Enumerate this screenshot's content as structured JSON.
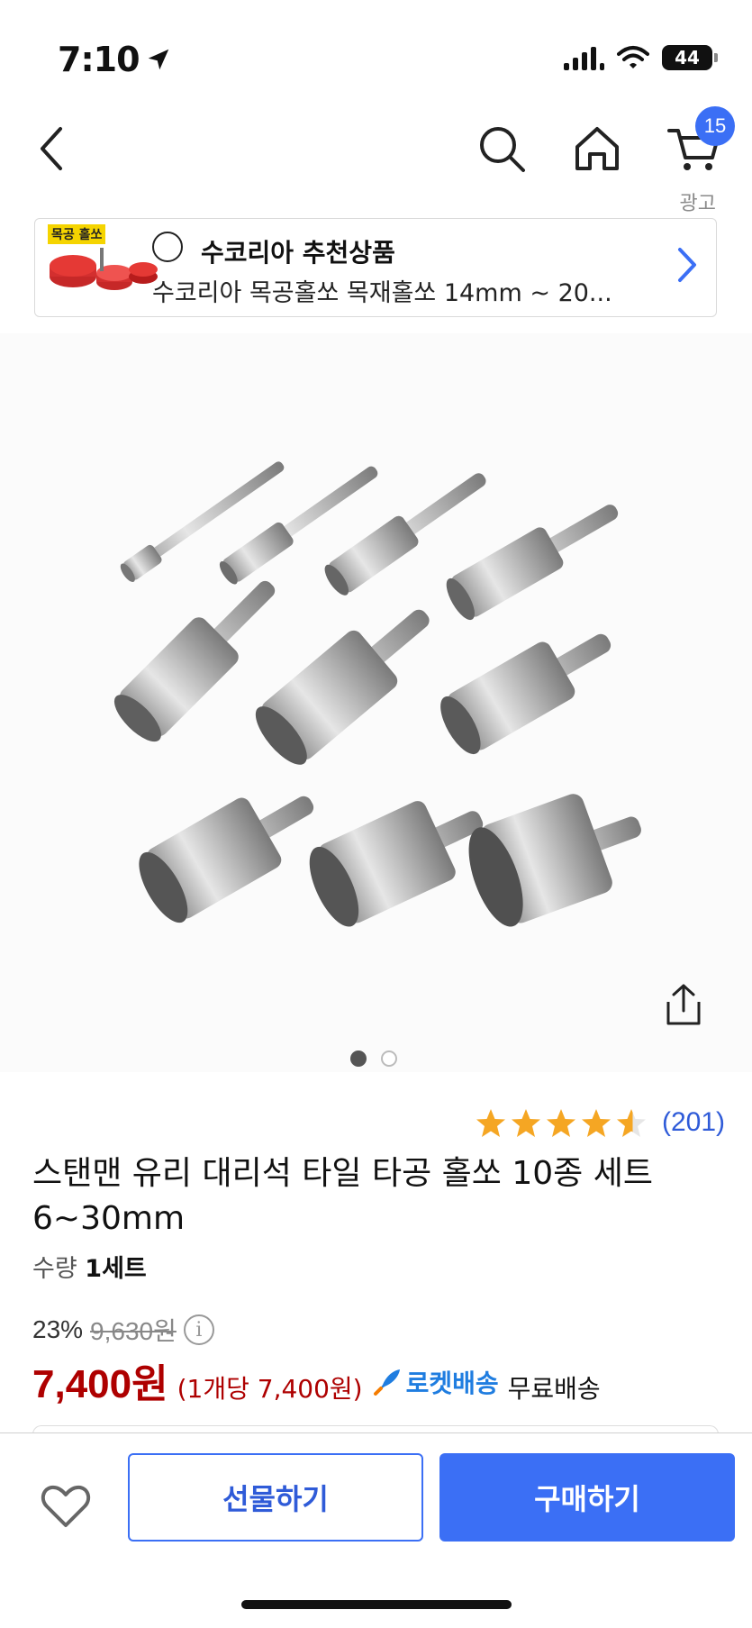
{
  "status_bar": {
    "time": "7:10",
    "battery": "44"
  },
  "nav": {
    "back_icon": "chevron-left-icon",
    "search_icon": "search-icon",
    "home_icon": "home-icon",
    "cart_icon": "cart-icon",
    "cart_badge": "15",
    "ad_label": "광고"
  },
  "ad_banner": {
    "thumb_tag": "목공 홀쏘",
    "brand_title": "수코리아 추천상품",
    "subtitle": "수코리아 목공홀쏘 목재홀쏘 14mm ~ 20..."
  },
  "gallery": {
    "page_count": 2,
    "active_index": 0
  },
  "product": {
    "rating": 4.5,
    "max_rating": 5,
    "review_count": "(201)",
    "title_line1": "스탠맨 유리 대리석 타일 타공 홀쏘 10종 세트",
    "title_line2": "6~30mm",
    "qty_label": "수량",
    "qty_value": "1세트",
    "discount_rate": "23%",
    "original_price": "9,630원",
    "price": "7,400원",
    "unit_price": "(1개당 7,400원)",
    "rocket_label": "로켓배송",
    "free_shipping": "무료배송"
  },
  "bottom_bar": {
    "wishlist_icon": "heart-icon",
    "gift_label": "선물하기",
    "buy_label": "구매하기"
  },
  "colors": {
    "accent": "#3b6ff5",
    "price_red": "#ae0000",
    "star": "#f5a623",
    "rocket": "#1f7de0"
  }
}
